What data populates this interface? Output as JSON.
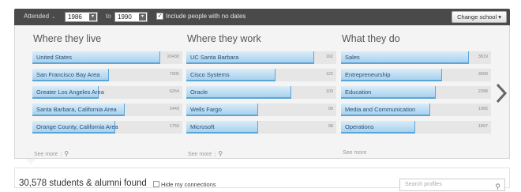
{
  "toolbar": {
    "attended_label": "Attended",
    "from_year": "1986",
    "to_label": "to",
    "to_year": "1990",
    "include_checkbox_checked": true,
    "include_label": "Include people with no dates",
    "change_school_label": "Change school ▾"
  },
  "columns": [
    {
      "title": "Where they live",
      "rows": [
        {
          "label": "United States",
          "count": "20430",
          "fill": 1.0
        },
        {
          "label": "San Francisco Bay Area",
          "count": "7905",
          "fill": 0.6
        },
        {
          "label": "Greater Los Angeles Area",
          "count": "6264",
          "fill": 0.52
        },
        {
          "label": "Santa Barbara, California Area",
          "count": "2443",
          "fill": 0.72
        },
        {
          "label": "Orange County, California Area",
          "count": "1750",
          "fill": 0.65
        }
      ],
      "see_more": "See more"
    },
    {
      "title": "Where they work",
      "rows": [
        {
          "label": "UC Santa Barbara",
          "count": "162",
          "fill": 1.0
        },
        {
          "label": "Cisco Systems",
          "count": "122",
          "fill": 0.7
        },
        {
          "label": "Oracle",
          "count": "100",
          "fill": 0.82
        },
        {
          "label": "Wells Fargo",
          "count": "99",
          "fill": 0.56
        },
        {
          "label": "Microsoft",
          "count": "98",
          "fill": 0.56
        }
      ],
      "see_more": "See more"
    },
    {
      "title": "What they do",
      "rows": [
        {
          "label": "Sales",
          "count": "3819",
          "fill": 1.0
        },
        {
          "label": "Entrepreneurship",
          "count": "3009",
          "fill": 0.79
        },
        {
          "label": "Education",
          "count": "2398",
          "fill": 0.74
        },
        {
          "label": "Media and Communication",
          "count": "1995",
          "fill": 0.7
        },
        {
          "label": "Operations",
          "count": "1897",
          "fill": 0.58
        }
      ],
      "see_more": "See more"
    }
  ],
  "results": {
    "count_text": "30,578 students & alumni found",
    "hide_connections_label": "Hide my connections",
    "search_placeholder": "Search profiles"
  },
  "colors": {
    "toolbar_bg": "#4a4a4a",
    "bar_fill": "#a9d1ee",
    "bar_edge": "#5ba6d9",
    "panel_bg": "#f4f4f4"
  }
}
